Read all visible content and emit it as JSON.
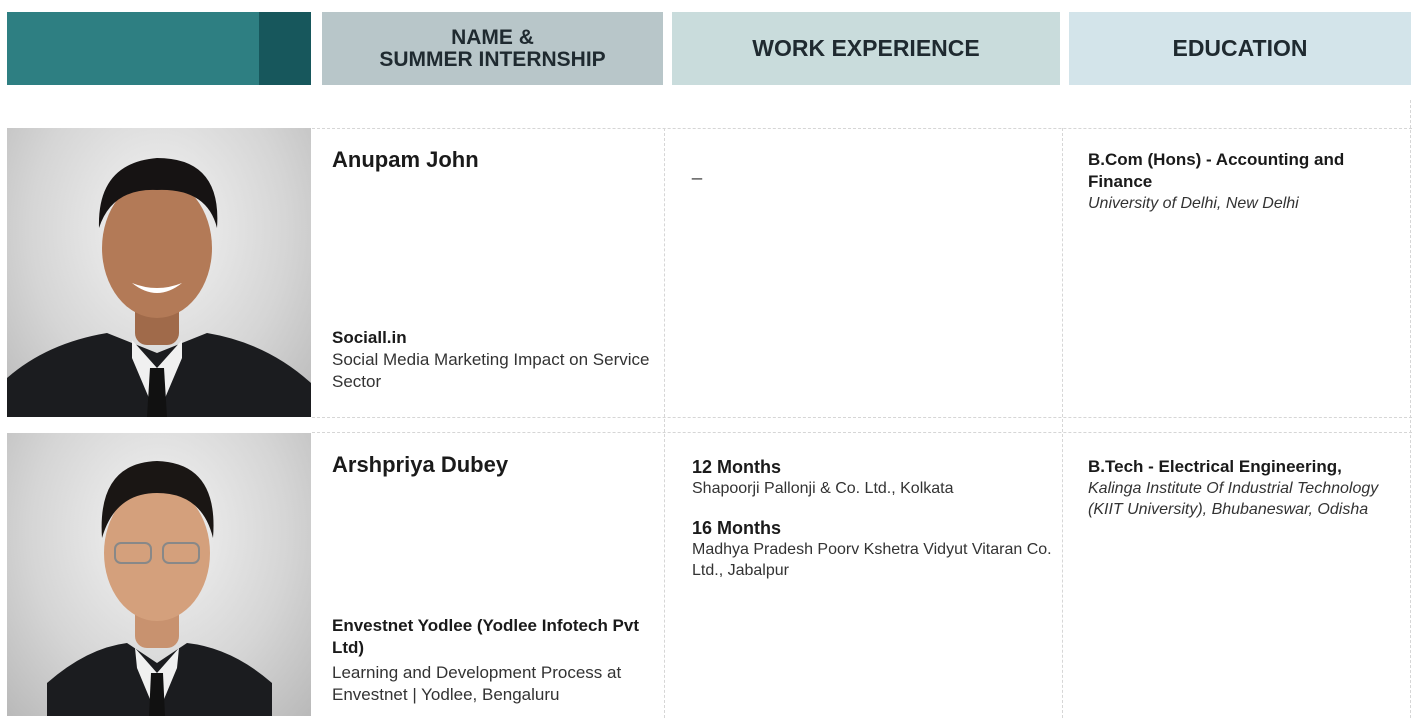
{
  "header": {
    "col_name": "NAME &",
    "col_name_2": "SUMMER INTERNSHIP",
    "col_work": "WORK EXPERIENCE",
    "col_edu": "EDUCATION"
  },
  "profiles": [
    {
      "name": "Anupam John",
      "internship_company": "Sociall.in",
      "internship_project": "Social Media Marketing Impact on Service Sector",
      "work_placeholder": "_",
      "degree": "B.Com (Hons) - Accounting and Finance",
      "institution": "University of Delhi, New Delhi"
    },
    {
      "name": "Arshpriya Dubey",
      "internship_company": "Envestnet Yodlee (Yodlee Infotech Pvt Ltd)",
      "internship_project": "Learning and Development Process at Envestnet | Yodlee, Bengaluru",
      "work": [
        {
          "duration": "12 Months",
          "org": "Shapoorji Pallonji & Co. Ltd., Kolkata"
        },
        {
          "duration": "16 Months",
          "org": "Madhya Pradesh Poorv Kshetra Vidyut Vitaran Co. Ltd., Jabalpur"
        }
      ],
      "degree": "B.Tech - Electrical Engineering,",
      "institution": "Kalinga Institute Of Industrial Technology (KIIT University), Bhubaneswar, Odisha"
    }
  ]
}
